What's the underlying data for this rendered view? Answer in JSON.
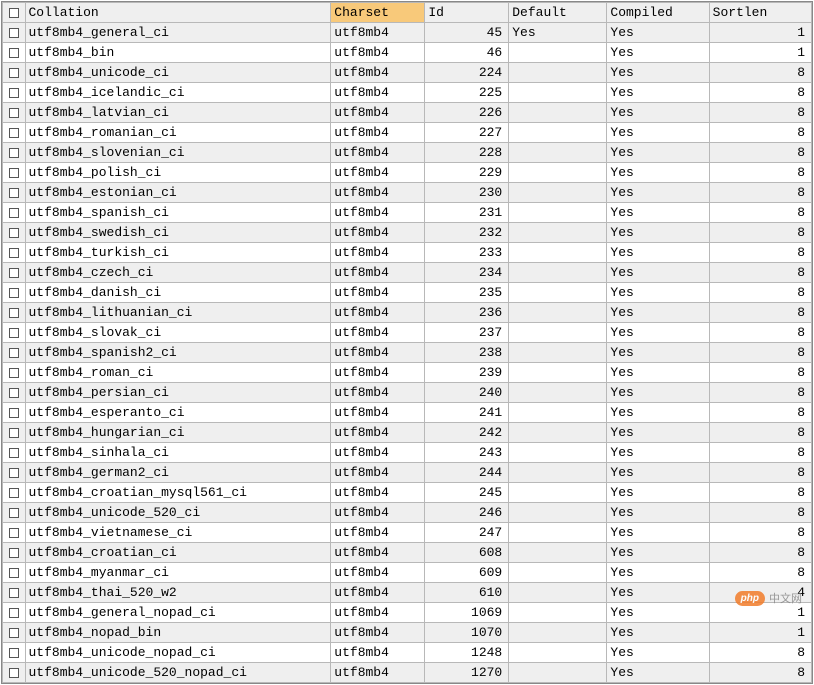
{
  "chart_data": {
    "type": "table",
    "title": "",
    "columns": [
      "Collation",
      "Charset",
      "Id",
      "Default",
      "Compiled",
      "Sortlen"
    ],
    "rows": [
      [
        "utf8mb4_general_ci",
        "utf8mb4",
        45,
        "Yes",
        "Yes",
        1
      ],
      [
        "utf8mb4_bin",
        "utf8mb4",
        46,
        "",
        "Yes",
        1
      ],
      [
        "utf8mb4_unicode_ci",
        "utf8mb4",
        224,
        "",
        "Yes",
        8
      ],
      [
        "utf8mb4_icelandic_ci",
        "utf8mb4",
        225,
        "",
        "Yes",
        8
      ],
      [
        "utf8mb4_latvian_ci",
        "utf8mb4",
        226,
        "",
        "Yes",
        8
      ],
      [
        "utf8mb4_romanian_ci",
        "utf8mb4",
        227,
        "",
        "Yes",
        8
      ],
      [
        "utf8mb4_slovenian_ci",
        "utf8mb4",
        228,
        "",
        "Yes",
        8
      ],
      [
        "utf8mb4_polish_ci",
        "utf8mb4",
        229,
        "",
        "Yes",
        8
      ],
      [
        "utf8mb4_estonian_ci",
        "utf8mb4",
        230,
        "",
        "Yes",
        8
      ],
      [
        "utf8mb4_spanish_ci",
        "utf8mb4",
        231,
        "",
        "Yes",
        8
      ],
      [
        "utf8mb4_swedish_ci",
        "utf8mb4",
        232,
        "",
        "Yes",
        8
      ],
      [
        "utf8mb4_turkish_ci",
        "utf8mb4",
        233,
        "",
        "Yes",
        8
      ],
      [
        "utf8mb4_czech_ci",
        "utf8mb4",
        234,
        "",
        "Yes",
        8
      ],
      [
        "utf8mb4_danish_ci",
        "utf8mb4",
        235,
        "",
        "Yes",
        8
      ],
      [
        "utf8mb4_lithuanian_ci",
        "utf8mb4",
        236,
        "",
        "Yes",
        8
      ],
      [
        "utf8mb4_slovak_ci",
        "utf8mb4",
        237,
        "",
        "Yes",
        8
      ],
      [
        "utf8mb4_spanish2_ci",
        "utf8mb4",
        238,
        "",
        "Yes",
        8
      ],
      [
        "utf8mb4_roman_ci",
        "utf8mb4",
        239,
        "",
        "Yes",
        8
      ],
      [
        "utf8mb4_persian_ci",
        "utf8mb4",
        240,
        "",
        "Yes",
        8
      ],
      [
        "utf8mb4_esperanto_ci",
        "utf8mb4",
        241,
        "",
        "Yes",
        8
      ],
      [
        "utf8mb4_hungarian_ci",
        "utf8mb4",
        242,
        "",
        "Yes",
        8
      ],
      [
        "utf8mb4_sinhala_ci",
        "utf8mb4",
        243,
        "",
        "Yes",
        8
      ],
      [
        "utf8mb4_german2_ci",
        "utf8mb4",
        244,
        "",
        "Yes",
        8
      ],
      [
        "utf8mb4_croatian_mysql561_ci",
        "utf8mb4",
        245,
        "",
        "Yes",
        8
      ],
      [
        "utf8mb4_unicode_520_ci",
        "utf8mb4",
        246,
        "",
        "Yes",
        8
      ],
      [
        "utf8mb4_vietnamese_ci",
        "utf8mb4",
        247,
        "",
        "Yes",
        8
      ],
      [
        "utf8mb4_croatian_ci",
        "utf8mb4",
        608,
        "",
        "Yes",
        8
      ],
      [
        "utf8mb4_myanmar_ci",
        "utf8mb4",
        609,
        "",
        "Yes",
        8
      ],
      [
        "utf8mb4_thai_520_w2",
        "utf8mb4",
        610,
        "",
        "Yes",
        4
      ],
      [
        "utf8mb4_general_nopad_ci",
        "utf8mb4",
        1069,
        "",
        "Yes",
        1
      ],
      [
        "utf8mb4_nopad_bin",
        "utf8mb4",
        1070,
        "",
        "Yes",
        1
      ],
      [
        "utf8mb4_unicode_nopad_ci",
        "utf8mb4",
        1248,
        "",
        "Yes",
        8
      ],
      [
        "utf8mb4_unicode_520_nopad_ci",
        "utf8mb4",
        1270,
        "",
        "Yes",
        8
      ]
    ]
  },
  "headers": {
    "collation": "Collation",
    "charset": "Charset",
    "id": "Id",
    "default": "Default",
    "compiled": "Compiled",
    "sortlen": "Sortlen"
  },
  "sorted_column": "charset",
  "rows": [
    {
      "collation": "utf8mb4_general_ci",
      "charset": "utf8mb4",
      "id": 45,
      "default": "Yes",
      "compiled": "Yes",
      "sortlen": 1
    },
    {
      "collation": "utf8mb4_bin",
      "charset": "utf8mb4",
      "id": 46,
      "default": "",
      "compiled": "Yes",
      "sortlen": 1
    },
    {
      "collation": "utf8mb4_unicode_ci",
      "charset": "utf8mb4",
      "id": 224,
      "default": "",
      "compiled": "Yes",
      "sortlen": 8
    },
    {
      "collation": "utf8mb4_icelandic_ci",
      "charset": "utf8mb4",
      "id": 225,
      "default": "",
      "compiled": "Yes",
      "sortlen": 8
    },
    {
      "collation": "utf8mb4_latvian_ci",
      "charset": "utf8mb4",
      "id": 226,
      "default": "",
      "compiled": "Yes",
      "sortlen": 8
    },
    {
      "collation": "utf8mb4_romanian_ci",
      "charset": "utf8mb4",
      "id": 227,
      "default": "",
      "compiled": "Yes",
      "sortlen": 8
    },
    {
      "collation": "utf8mb4_slovenian_ci",
      "charset": "utf8mb4",
      "id": 228,
      "default": "",
      "compiled": "Yes",
      "sortlen": 8
    },
    {
      "collation": "utf8mb4_polish_ci",
      "charset": "utf8mb4",
      "id": 229,
      "default": "",
      "compiled": "Yes",
      "sortlen": 8
    },
    {
      "collation": "utf8mb4_estonian_ci",
      "charset": "utf8mb4",
      "id": 230,
      "default": "",
      "compiled": "Yes",
      "sortlen": 8
    },
    {
      "collation": "utf8mb4_spanish_ci",
      "charset": "utf8mb4",
      "id": 231,
      "default": "",
      "compiled": "Yes",
      "sortlen": 8
    },
    {
      "collation": "utf8mb4_swedish_ci",
      "charset": "utf8mb4",
      "id": 232,
      "default": "",
      "compiled": "Yes",
      "sortlen": 8
    },
    {
      "collation": "utf8mb4_turkish_ci",
      "charset": "utf8mb4",
      "id": 233,
      "default": "",
      "compiled": "Yes",
      "sortlen": 8
    },
    {
      "collation": "utf8mb4_czech_ci",
      "charset": "utf8mb4",
      "id": 234,
      "default": "",
      "compiled": "Yes",
      "sortlen": 8
    },
    {
      "collation": "utf8mb4_danish_ci",
      "charset": "utf8mb4",
      "id": 235,
      "default": "",
      "compiled": "Yes",
      "sortlen": 8
    },
    {
      "collation": "utf8mb4_lithuanian_ci",
      "charset": "utf8mb4",
      "id": 236,
      "default": "",
      "compiled": "Yes",
      "sortlen": 8
    },
    {
      "collation": "utf8mb4_slovak_ci",
      "charset": "utf8mb4",
      "id": 237,
      "default": "",
      "compiled": "Yes",
      "sortlen": 8
    },
    {
      "collation": "utf8mb4_spanish2_ci",
      "charset": "utf8mb4",
      "id": 238,
      "default": "",
      "compiled": "Yes",
      "sortlen": 8
    },
    {
      "collation": "utf8mb4_roman_ci",
      "charset": "utf8mb4",
      "id": 239,
      "default": "",
      "compiled": "Yes",
      "sortlen": 8
    },
    {
      "collation": "utf8mb4_persian_ci",
      "charset": "utf8mb4",
      "id": 240,
      "default": "",
      "compiled": "Yes",
      "sortlen": 8
    },
    {
      "collation": "utf8mb4_esperanto_ci",
      "charset": "utf8mb4",
      "id": 241,
      "default": "",
      "compiled": "Yes",
      "sortlen": 8
    },
    {
      "collation": "utf8mb4_hungarian_ci",
      "charset": "utf8mb4",
      "id": 242,
      "default": "",
      "compiled": "Yes",
      "sortlen": 8
    },
    {
      "collation": "utf8mb4_sinhala_ci",
      "charset": "utf8mb4",
      "id": 243,
      "default": "",
      "compiled": "Yes",
      "sortlen": 8
    },
    {
      "collation": "utf8mb4_german2_ci",
      "charset": "utf8mb4",
      "id": 244,
      "default": "",
      "compiled": "Yes",
      "sortlen": 8
    },
    {
      "collation": "utf8mb4_croatian_mysql561_ci",
      "charset": "utf8mb4",
      "id": 245,
      "default": "",
      "compiled": "Yes",
      "sortlen": 8
    },
    {
      "collation": "utf8mb4_unicode_520_ci",
      "charset": "utf8mb4",
      "id": 246,
      "default": "",
      "compiled": "Yes",
      "sortlen": 8
    },
    {
      "collation": "utf8mb4_vietnamese_ci",
      "charset": "utf8mb4",
      "id": 247,
      "default": "",
      "compiled": "Yes",
      "sortlen": 8
    },
    {
      "collation": "utf8mb4_croatian_ci",
      "charset": "utf8mb4",
      "id": 608,
      "default": "",
      "compiled": "Yes",
      "sortlen": 8
    },
    {
      "collation": "utf8mb4_myanmar_ci",
      "charset": "utf8mb4",
      "id": 609,
      "default": "",
      "compiled": "Yes",
      "sortlen": 8
    },
    {
      "collation": "utf8mb4_thai_520_w2",
      "charset": "utf8mb4",
      "id": 610,
      "default": "",
      "compiled": "Yes",
      "sortlen": 4
    },
    {
      "collation": "utf8mb4_general_nopad_ci",
      "charset": "utf8mb4",
      "id": 1069,
      "default": "",
      "compiled": "Yes",
      "sortlen": 1
    },
    {
      "collation": "utf8mb4_nopad_bin",
      "charset": "utf8mb4",
      "id": 1070,
      "default": "",
      "compiled": "Yes",
      "sortlen": 1
    },
    {
      "collation": "utf8mb4_unicode_nopad_ci",
      "charset": "utf8mb4",
      "id": 1248,
      "default": "",
      "compiled": "Yes",
      "sortlen": 8
    },
    {
      "collation": "utf8mb4_unicode_520_nopad_ci",
      "charset": "utf8mb4",
      "id": 1270,
      "default": "",
      "compiled": "Yes",
      "sortlen": 8
    }
  ],
  "watermark": {
    "badge": "php",
    "text": "中文网"
  }
}
